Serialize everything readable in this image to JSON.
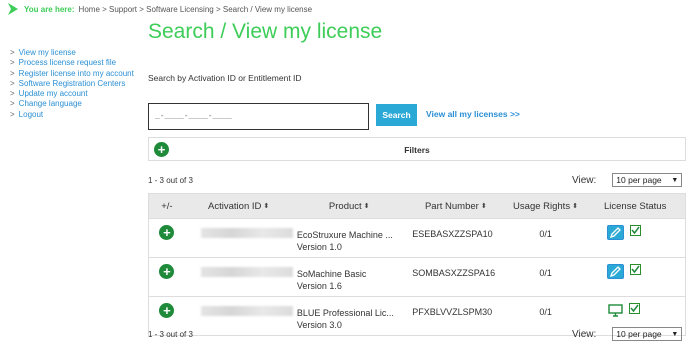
{
  "breadcrumb": {
    "prefix": "You are here:",
    "path": "Home > Support > Software Licensing > Search / View my license"
  },
  "sidenav": [
    "View my license",
    "Process license request file",
    "Register license into my account",
    "Software Registration Centers",
    "Update my account",
    "Change language",
    "Logout"
  ],
  "page_title": "Search / View my license",
  "search": {
    "label": "Search by Activation ID or Entitlement ID",
    "placeholder": "_-____-____-____",
    "button": "Search",
    "view_all": "View all my licenses >>"
  },
  "filters_label": "Filters",
  "results_count": "1 - 3 out of 3",
  "view_label": "View:",
  "per_page": "10 per page",
  "columns": [
    "+/-",
    "Activation ID",
    "Product",
    "Part Number",
    "Usage Rights",
    "License Status"
  ],
  "rows": [
    {
      "product_line1": "EcoStruxure Machine ...",
      "product_line2": "Version 1.0",
      "part_number": "ESEBASXZZSPA10",
      "usage": "0/1",
      "status_icon": "edit-icon"
    },
    {
      "product_line1": "SoMachine Basic",
      "product_line2": "Version 1.6",
      "part_number": "SOMBASXZZSPA16",
      "usage": "0/1",
      "status_icon": "edit-icon"
    },
    {
      "product_line1": "BLUE Professional Lic...",
      "product_line2": "Version 3.0",
      "part_number": "PFXBLVVZLSPM30",
      "usage": "0/1",
      "status_icon": "computer-icon"
    }
  ],
  "colors": {
    "brand_green": "#3dcd58",
    "link_blue": "#2a8fd4",
    "button_blue": "#2ba9d6",
    "plus_green": "#1e8a3a"
  }
}
